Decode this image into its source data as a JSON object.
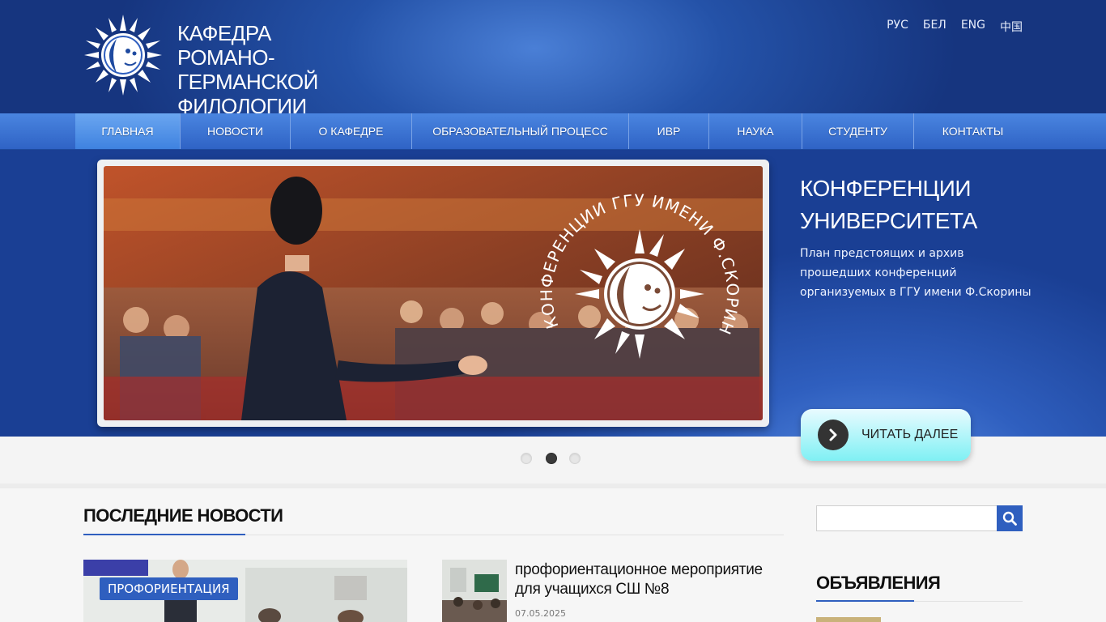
{
  "header": {
    "title_lines": [
      "КАФЕДРА РОМАНО-",
      "ГЕРМАНСКОЙ",
      "ФИЛОЛОГИИ"
    ],
    "languages": [
      "РУС",
      "БЕЛ",
      "ENG",
      "中国"
    ]
  },
  "nav": {
    "items": [
      {
        "label": "ГЛАВНАЯ",
        "active": true
      },
      {
        "label": "НОВОСТИ",
        "active": false
      },
      {
        "label": "О КАФЕДРЕ",
        "active": false
      },
      {
        "label": "ОБРАЗОВАТЕЛЬНЫЙ ПРОЦЕСС",
        "active": false
      },
      {
        "label": "ИВР",
        "active": false
      },
      {
        "label": "НАУКА",
        "active": false
      },
      {
        "label": "СТУДЕНТУ",
        "active": false
      },
      {
        "label": "КОНТАКТЫ",
        "active": false
      }
    ]
  },
  "slider": {
    "image_caption": "КОНФЕРЕНЦИИ ГГУ ИМЕНИ Ф.СКОРИНЫ",
    "title_lines": [
      "КОНФЕРЕНЦИИ",
      "УНИВЕРСИТЕТА"
    ],
    "description": "План предстоящих и архив прошедших конференций организуемых в ГГУ имени Ф.Скорины",
    "read_more": "ЧИТАТЬ ДАЛЕЕ",
    "slide_count": 3,
    "active_slide": 2
  },
  "news": {
    "heading": "ПОСЛЕДНИЕ НОВОСТИ",
    "main_tag": "ПРОФОРИЕНТАЦИЯ",
    "item_title": "профориентационное мероприятие для учащихся СШ №8",
    "item_date": "07.05.2025"
  },
  "sidebar": {
    "search_placeholder": "",
    "announcements_heading": "ОБЪЯВЛЕНИЯ"
  },
  "colors": {
    "accent_blue": "#2f5fbf",
    "header_dark": "#16357f",
    "read_more_bg": "#7ff0f4"
  },
  "icons": [
    "sun-logo-icon",
    "search-icon",
    "chevron-right-icon"
  ]
}
